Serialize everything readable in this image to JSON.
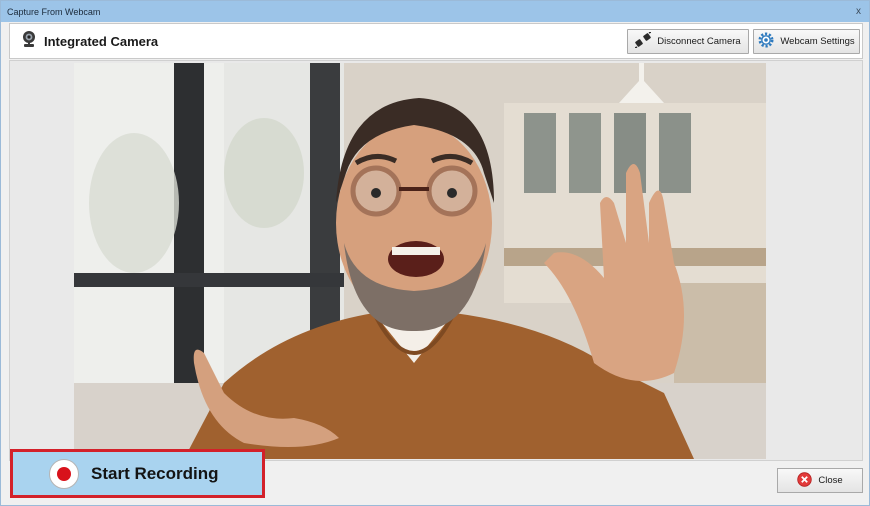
{
  "window": {
    "title": "Capture From Webcam",
    "close_glyph": "x"
  },
  "header": {
    "camera_name": "Integrated Camera",
    "camera_icon": "webcam-icon",
    "disconnect_label": "Disconnect Camera",
    "disconnect_icon": "plug-disconnect-icon",
    "settings_label": "Webcam Settings",
    "settings_icon": "gear-icon"
  },
  "preview": {
    "content": "live-webcam-feed"
  },
  "footer": {
    "record_label": "Start Recording",
    "record_icon": "record-icon",
    "close_label": "Close",
    "close_icon": "close-circle-icon"
  },
  "colors": {
    "title_bar": "#9cc4e8",
    "record_button": "#a9d3ef",
    "record_highlight": "#d3212a",
    "record_dot": "#d8121b"
  }
}
